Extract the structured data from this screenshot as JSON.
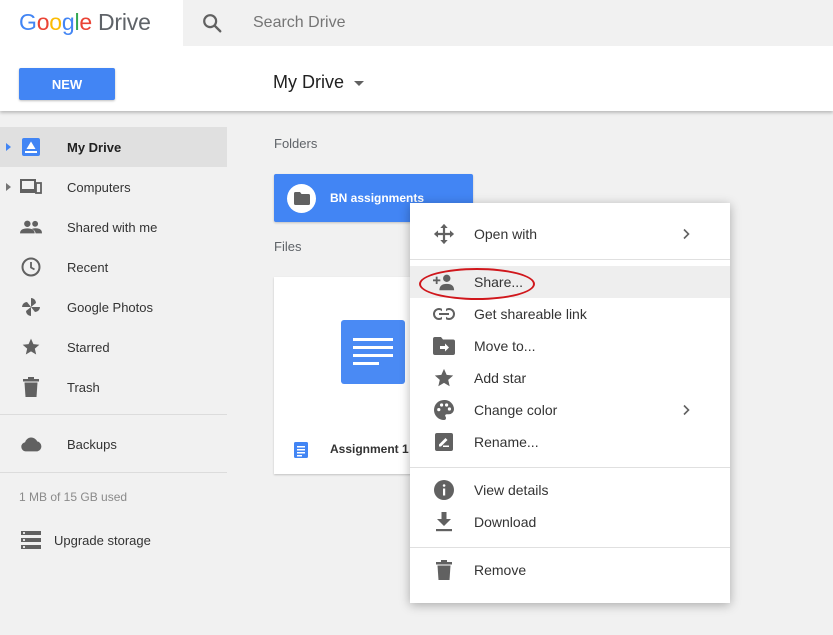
{
  "header": {
    "logo": {
      "letters": [
        "G",
        "o",
        "o",
        "g",
        "l",
        "e"
      ],
      "product": "Drive"
    },
    "search": {
      "placeholder": "Search Drive",
      "value": ""
    },
    "new_button": "NEW",
    "title": "My Drive"
  },
  "sidebar": {
    "items": [
      {
        "label": "My Drive",
        "icon": "my-drive-icon",
        "active": true,
        "expandable": true
      },
      {
        "label": "Computers",
        "icon": "computers-icon",
        "active": false,
        "expandable": true
      },
      {
        "label": "Shared with me",
        "icon": "people-icon",
        "active": false,
        "expandable": false
      },
      {
        "label": "Recent",
        "icon": "clock-icon",
        "active": false,
        "expandable": false
      },
      {
        "label": "Google Photos",
        "icon": "photos-pinwheel-icon",
        "active": false,
        "expandable": false
      },
      {
        "label": "Starred",
        "icon": "star-icon",
        "active": false,
        "expandable": false
      },
      {
        "label": "Trash",
        "icon": "trash-icon",
        "active": false,
        "expandable": false
      }
    ],
    "backups": {
      "label": "Backups",
      "icon": "cloud-icon"
    },
    "storage": "1 MB of 15 GB used",
    "upgrade": {
      "label": "Upgrade storage",
      "icon": "storage-icon"
    }
  },
  "main": {
    "folders_label": "Folders",
    "folders": [
      {
        "name": "BN assignments"
      }
    ],
    "files_label": "Files",
    "files": [
      {
        "name": "Assignment 1"
      }
    ]
  },
  "context_menu": {
    "groups": [
      [
        {
          "label": "Open with",
          "icon": "move-arrows-icon",
          "submenu": true
        }
      ],
      [
        {
          "label": "Share...",
          "icon": "add-person-icon",
          "submenu": false,
          "highlighted": true
        },
        {
          "label": "Get shareable link",
          "icon": "link-icon",
          "submenu": false
        },
        {
          "label": "Move to...",
          "icon": "move-folder-icon",
          "submenu": false
        },
        {
          "label": "Add star",
          "icon": "star-icon",
          "submenu": false
        },
        {
          "label": "Change color",
          "icon": "palette-icon",
          "submenu": true
        },
        {
          "label": "Rename...",
          "icon": "rename-icon",
          "submenu": false
        }
      ],
      [
        {
          "label": "View details",
          "icon": "info-icon",
          "submenu": false
        },
        {
          "label": "Download",
          "icon": "download-icon",
          "submenu": false
        }
      ],
      [
        {
          "label": "Remove",
          "icon": "trash-icon",
          "submenu": false
        }
      ]
    ]
  },
  "colors": {
    "accent": "#4285f4",
    "icon_grey": "#616161",
    "annotation_red": "#d0171c",
    "active_nav_bg": "#e0e0e0"
  }
}
